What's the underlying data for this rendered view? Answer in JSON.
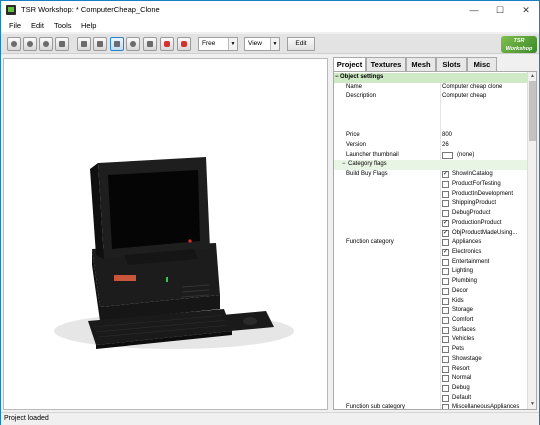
{
  "window": {
    "title": "TSR Workshop: * ComputerCheap_Clone",
    "minimize": "—",
    "maximize": "☐",
    "close": "✕"
  },
  "menu": [
    "File",
    "Edit",
    "Tools",
    "Help"
  ],
  "toolbar": {
    "camera_mode": "Free",
    "view_mode": "View",
    "edit_label": "Edit",
    "logo_line1": "TSR",
    "logo_line2": "Workshop"
  },
  "tabs": [
    "Project",
    "Textures",
    "Mesh",
    "Slots",
    "Misc"
  ],
  "active_tab": "Project",
  "properties": {
    "group_title": "Object settings",
    "name_label": "Name",
    "name_value": "Computer cheap clone",
    "description_label": "Description",
    "description_value": "Computer cheap",
    "price_label": "Price",
    "price_value": "800",
    "version_label": "Version",
    "version_value": "26",
    "thumbnail_label": "Launcher thumbnail",
    "thumbnail_value": "(none)",
    "category_flags_title": "Category flags",
    "build_buy_label": "Build Buy Flags",
    "build_buy_flags": [
      {
        "label": "ShowInCatalog",
        "checked": true
      },
      {
        "label": "ProductForTesting",
        "checked": false
      },
      {
        "label": "ProductInDevelopment",
        "checked": false
      },
      {
        "label": "ShippingProduct",
        "checked": false
      },
      {
        "label": "DebugProduct",
        "checked": false
      },
      {
        "label": "ProductionProduct",
        "checked": true
      },
      {
        "label": "ObjProductMadeUsing...",
        "checked": true
      }
    ],
    "function_category_label": "Function category",
    "function_categories": [
      {
        "label": "Appliances",
        "checked": false
      },
      {
        "label": "Electronics",
        "checked": true
      },
      {
        "label": "Entertainment",
        "checked": false
      },
      {
        "label": "Lighting",
        "checked": false
      },
      {
        "label": "Plumbing",
        "checked": false
      },
      {
        "label": "Decor",
        "checked": false
      },
      {
        "label": "Kids",
        "checked": false
      },
      {
        "label": "Storage",
        "checked": false
      },
      {
        "label": "Comfort",
        "checked": false
      },
      {
        "label": "Surfaces",
        "checked": false
      },
      {
        "label": "Vehicles",
        "checked": false
      },
      {
        "label": "Pets",
        "checked": false
      },
      {
        "label": "Showstage",
        "checked": false
      },
      {
        "label": "Resort",
        "checked": false
      },
      {
        "label": "Normal",
        "checked": false
      },
      {
        "label": "Debug",
        "checked": false
      },
      {
        "label": "Default",
        "checked": false
      }
    ],
    "function_sub_category_label": "Function sub category",
    "function_sub_categories": [
      {
        "label": "MiscellaneousAppliances",
        "checked": false
      }
    ]
  },
  "status": "Project loaded",
  "colors": {
    "title_border": "#1b7fc4",
    "group_header": "#cfe9c6",
    "logo_green": "#5aa83a"
  }
}
